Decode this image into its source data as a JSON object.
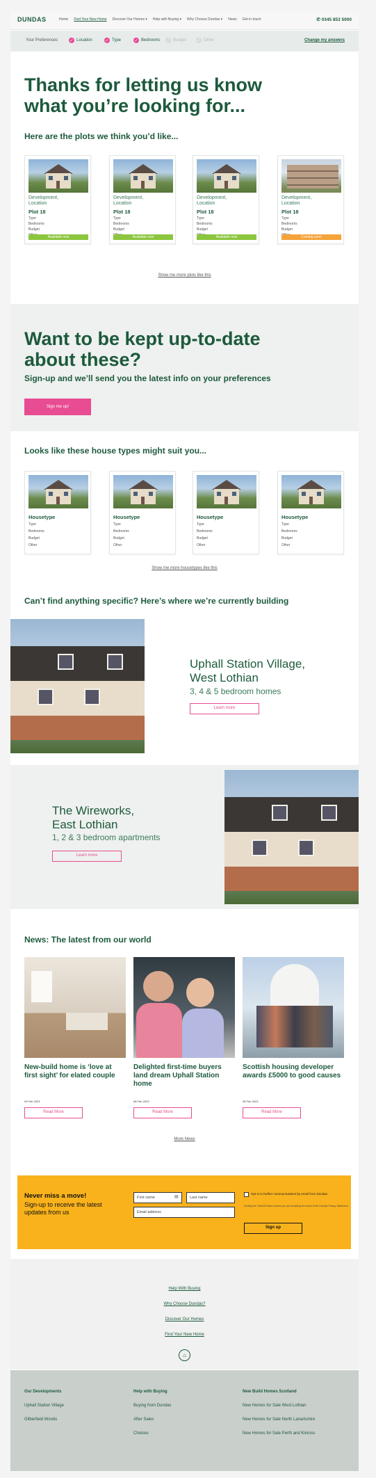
{
  "nav": {
    "logo": "DUNDAS",
    "items": [
      "Home",
      "Find Your New Home",
      "Discover Our Homes ▾",
      "Help with Buying ▾",
      "Why Choose Dundas ▾",
      "News",
      "Get in touch"
    ],
    "phone": "0345 853 5000"
  },
  "prefs": {
    "label": "Your Preferences",
    "items": [
      {
        "label": "Location",
        "on": true
      },
      {
        "label": "Type",
        "on": true
      },
      {
        "label": "Bedrooms",
        "on": true
      },
      {
        "label": "Budget",
        "on": false
      },
      {
        "label": "Other",
        "on": false
      }
    ],
    "change": "Change my answers"
  },
  "hero": {
    "title_line1": "Thanks for letting us know",
    "title_line2": "what you’re looking for...",
    "subtitle": "Here are the plots we think you’d like..."
  },
  "plots": [
    {
      "dev": "Development,",
      "loc": "Location",
      "plot": "Plot 18",
      "type": "Type",
      "bed": "Bedrooms",
      "budget": "Budget",
      "other": "Other",
      "status": "Available now",
      "soon": false
    },
    {
      "dev": "Development,",
      "loc": "Location",
      "plot": "Plot 18",
      "type": "Type",
      "bed": "Bedrooms",
      "budget": "Budget",
      "other": "Other",
      "status": "Available now",
      "soon": false
    },
    {
      "dev": "Development,",
      "loc": "Location",
      "plot": "Plot 18",
      "type": "Type",
      "bed": "Bedrooms",
      "budget": "Budget",
      "other": "Other",
      "status": "Available now",
      "soon": false
    },
    {
      "dev": "Development,",
      "loc": "Location",
      "plot": "Plot 18",
      "type": "Type",
      "bed": "Bedrooms",
      "budget": "Budget",
      "other": "Other",
      "status": "Coming soon",
      "soon": true
    }
  ],
  "more_plots": "Show me more plots like this",
  "uptodate": {
    "title_line1": "Want to be kept up-to-date",
    "title_line2": "about these?",
    "subtitle": "Sign-up and we’ll send you the latest info on your preferences",
    "button": "Sign me up!"
  },
  "housetypes": {
    "title": "Looks like these house types might suit you...",
    "cards": [
      {
        "name": "Housetype",
        "type": "Type",
        "bed": "Bedrooms",
        "budget": "Budget",
        "other": "Other"
      },
      {
        "name": "Housetype",
        "type": "Type",
        "bed": "Bedrooms",
        "budget": "Budget",
        "other": "Other"
      },
      {
        "name": "Housetype",
        "type": "Type",
        "bed": "Bedrooms",
        "budget": "Budget",
        "other": "Other"
      },
      {
        "name": "Housetype",
        "type": "Type",
        "bed": "Bedrooms",
        "budget": "Budget",
        "other": "Other"
      }
    ],
    "more": "Show me more housetypes like this"
  },
  "building": {
    "title": "Can’t find anything specific? Here’s where we’re currently building"
  },
  "dev1": {
    "line1": "Uphall Station Village,",
    "line2": "West Lothian",
    "sub": "3, 4 & 5 bedroom homes",
    "button": "Learn more"
  },
  "dev2": {
    "line1": "The Wireworks,",
    "line2": "East Lothian",
    "sub": "1, 2 & 3 bedroom apartments",
    "button": "Learn more"
  },
  "news": {
    "title": "News: The latest from our world",
    "items": [
      {
        "title": "New-build home is ‘love at first sight’ for elated couple",
        "date": "09 Feb 2023",
        "button": "Read More"
      },
      {
        "title": "Delighted first-time buyers land dream Uphall Station home",
        "date": "08 Feb 2023",
        "button": "Read More"
      },
      {
        "title": "Scottish housing developer awards £5000 to good causes",
        "date": "08 Feb 2023",
        "button": "Read More"
      }
    ],
    "more": "More News"
  },
  "signup": {
    "title": "Never miss a move!",
    "sub_line1": "Sign-up to receive the latest",
    "sub_line2": "updates from us",
    "first": "First name",
    "last": "Last name",
    "email": "Email address",
    "optin": "Opt in to further communications by email from Dundas",
    "note": "Clicking the 'Submit' button means you are accepting the terms of the Dundas Privacy Statement",
    "button": "Sign up"
  },
  "footlinks": [
    "Help With Buying",
    "Why Choose Dundas?",
    "Discover Our Homes",
    "Find Your New Home"
  ],
  "footer": {
    "cols": [
      {
        "head": "Our Developments",
        "items": [
          "Uphall Station Village",
          "Gilberfield Woods"
        ]
      },
      {
        "head": "Help with Buying",
        "items": [
          "Buying from Dundas",
          "After Sales",
          "Choices"
        ]
      },
      {
        "head": "New Build Homes Scotland",
        "items": [
          "New Homes for Sale West Lothian",
          "New Homes for Sale North Lanarkshire",
          "New Homes for Sale Perth and Kinross"
        ]
      }
    ]
  }
}
